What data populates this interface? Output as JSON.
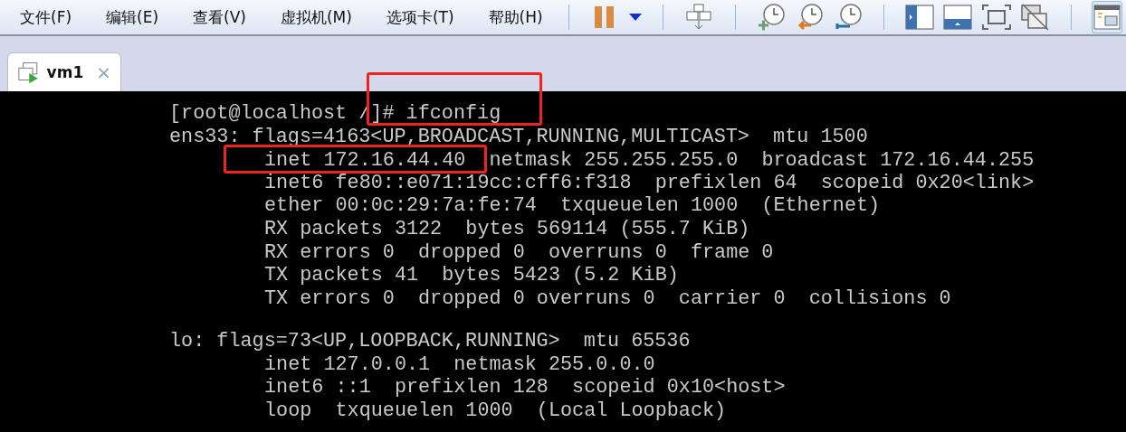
{
  "menu": [
    {
      "label": "文件(F)"
    },
    {
      "label": "编辑(E)"
    },
    {
      "label": "查看(V)"
    },
    {
      "label": "虚拟机(M)"
    },
    {
      "label": "选项卡(T)"
    },
    {
      "label": "帮助(H)"
    }
  ],
  "toolbar": [
    {
      "kind": "separator"
    },
    {
      "kind": "pause",
      "pressed": false
    },
    {
      "kind": "dropdown",
      "pressed": false
    },
    {
      "kind": "separator"
    },
    {
      "kind": "network",
      "pressed": false
    },
    {
      "kind": "separator"
    },
    {
      "kind": "clock-add",
      "pressed": false
    },
    {
      "kind": "clock-back",
      "pressed": false
    },
    {
      "kind": "clock-wrench",
      "pressed": false
    },
    {
      "kind": "separator"
    },
    {
      "kind": "view-sidebar",
      "pressed": false
    },
    {
      "kind": "view-bottom",
      "pressed": false
    },
    {
      "kind": "view-full",
      "pressed": false
    },
    {
      "kind": "view-off",
      "pressed": false
    },
    {
      "kind": "separator"
    },
    {
      "kind": "view-unity",
      "pressed": true
    }
  ],
  "tabs": [
    {
      "label": "vm1",
      "close": "×",
      "selected": true
    }
  ],
  "terminal": {
    "blocks": [
      {
        "lines": [
          {
            "kind": "flush",
            "text": "[root@localhost /]# ifconfig"
          },
          {
            "kind": "flush",
            "text": "ens33: flags=4163<UP,BROADCAST,RUNNING,MULTICAST>  mtu 1500"
          },
          {
            "kind": "indented",
            "segments": [
              "inet 172.16.44.40",
              "netmask 255.255.255.0  broadcast 172.16.44.255"
            ]
          },
          {
            "kind": "indented",
            "text": "inet6 fe80::e071:19cc:cff6:f318  prefixlen 64  scopeid 0x20<link>"
          },
          {
            "kind": "indented",
            "text": "ether 00:0c:29:7a:fe:74  txqueuelen 1000  (Ethernet)"
          },
          {
            "kind": "indented",
            "text": "RX packets 3122  bytes 569114 (555.7 KiB)"
          },
          {
            "kind": "indented",
            "text": "RX errors 0  dropped 0  overruns 0  frame 0"
          },
          {
            "kind": "indented",
            "text": "TX packets 41  bytes 5423 (5.2 KiB)"
          },
          {
            "kind": "indented",
            "text": "TX errors 0  dropped 0 overruns 0  carrier 0  collisions 0"
          }
        ]
      },
      {
        "lines": [
          {
            "kind": "flush",
            "text": "lo: flags=73<UP,LOOPBACK,RUNNING>  mtu 65536"
          },
          {
            "kind": "indented",
            "text": "inet 127.0.0.1  netmask 255.0.0.0"
          },
          {
            "kind": "indented",
            "text": "inet6 ::1  prefixlen 128  scopeid 0x10<host>"
          },
          {
            "kind": "indented",
            "text": "loop  txqueuelen 1000  (Local Loopback)"
          }
        ]
      }
    ]
  },
  "annotations": [
    {
      "kind": "box"
    },
    {
      "kind": "box"
    }
  ]
}
